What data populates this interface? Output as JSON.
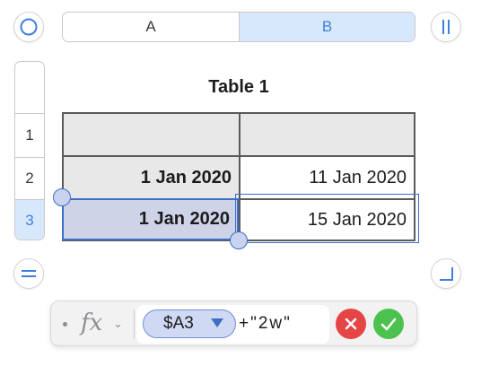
{
  "column_headers": [
    "A",
    "B"
  ],
  "row_headers": [
    "1",
    "2",
    "3"
  ],
  "table": {
    "title": "Table 1",
    "rows": [
      [
        "",
        ""
      ],
      [
        "1 Jan 2020",
        "11 Jan 2020"
      ],
      [
        "1 Jan 2020",
        "15 Jan 2020"
      ]
    ]
  },
  "formula": {
    "fx_label": "fx",
    "chevron": "⌄",
    "reference": "$A3",
    "expression": "+\"2w\""
  },
  "icons": {
    "select_all": "circle-icon",
    "column_handle": "pause-icon",
    "row_handle": "equals-icon",
    "table_resize": "corner-icon",
    "cancel": "x-icon",
    "accept": "checkmark-icon"
  },
  "colors": {
    "accent": "#3c6fc5",
    "selected_header": "#d8e8fb",
    "cancel": "#e64545",
    "accept": "#4cc24e"
  }
}
